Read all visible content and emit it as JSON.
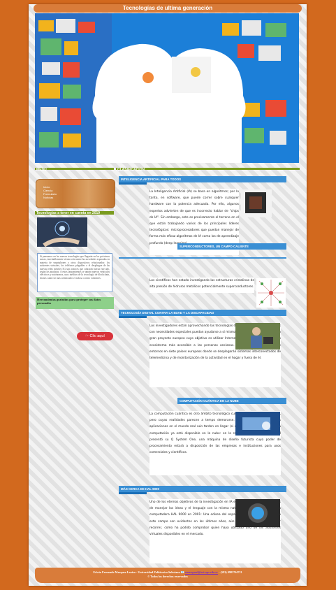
{
  "header": {
    "title": "Tecnologías de ultima generación"
  },
  "sidebar": {
    "menu_label": "MENÚ",
    "items": [
      {
        "label": "Inicio"
      },
      {
        "label": "Ciencia"
      },
      {
        "label": "Formulario"
      },
      {
        "label": "Noticias"
      }
    ],
    "tech_title": "Tecnologías a tener en cuenta en 2019",
    "tech_text": "Si pensamos en las nuevas tecnologías que llegarán en los próximos meses, inevitablemente vienen a la mente las novedades esperadas en materia de smartphones y otros dispositivos relacionados: los asistentes virtuales, los teléfonos plegables o el despliegue de las nuevas redes móviles 5G son avances que cobrarán fuerza este año, según los analistas. A estos lanzamientos se unirán nuevos vehículos eléctricos y autónomos, usos inéditos de la tecnología de blockchain, drones cada vez más sofisticados e incluso coches voladores.",
    "tools_title": "Herramientas gratuitas para proteger sus datos personales",
    "clic_label": "Clic aquí"
  },
  "main": {
    "section_label": "CLASIFICACIÓN",
    "articles": [
      {
        "title": "INTELIGENCIA ARTIFICIAL PARA TODOS",
        "text": "La Inteligencia Artificial (IA) se basa en algoritmos; por lo tanto, en software, que puede correr sobre cualquier hardware con la potencia adecuada. Por ello, algunos expertos advierten de que es incorrecto hablar de \"chips de IA\". Sin embargo, este es precisamente el terreno en el que están trabajando varios de los principales líderes tecnológicos: microprocesadores que puedan manejar de forma más eficaz algoritmos de IA como los de aprendizaje profundo (deep learning)."
      },
      {
        "title": "SUPERCONDUCTORES, UN CAMPO CALIENTE",
        "text": "Los científicos han estado investigando las estructuras cristalinas de alta presión de hidruros metálicos potencialmente superconductores."
      },
      {
        "title": "TECNOLOGÍA DIGITAL CONTRA LA EDAD Y LA DISCAPACIDAD",
        "text": "Los investigadores están aprovechando las tecnologías digitales para que las personas con necesidades especiales puedan ayudarse a sí mismas. Es el caso de ACTIVAGE, un gran proyecto europeo cuyo objetivo es utilizar Internet de las Cosas para crear un ecosistema más accesible a las personas ancianas. El objetivo es crear nueve entornos en siete países europeos donde se desplegarán sistemas interconectados de telemedicina y de monitorización de la actividad en el hogar y fuera de él."
      },
      {
        "title": "COMPUTACIÓN CUÁNTICA EN LA NUBE",
        "text": "La computación cuántica es otro ámbito tecnológico cuyas promesas son tentadoras, pero cuyas realidades parecen a tempo demorarse. No obstante y aunque sus aplicaciones en el mundo real aún tarden en llegar (si es que llegan), el futuro de la computación ya está disponible en la nube: en la reciente edición del CES, IBM presentó su Q System One, una máquina de diseño futurista cuyo poder de procesamiento estará a disposición de las empresas e instituciones para usos comerciales y científicos."
      },
      {
        "title": "MÁS CERCA DE HAL 9000",
        "text": "Uno de los eternos objetivos de la investigación en IA es conseguir sistemas capaces de manejar las ideas y el lenguaje con la misma naturalidad con que lo hacía la computadora HAL 9000 en 2001: Una odisea del espacio. Aunque los progresos en este campo son evidentes en los últimos años, aún queda un largo camino por recorrer, como ha podido comprobar quien haya utilizado uno de los asistentes virtuales disponibles en el mercado."
      }
    ]
  },
  "footer": {
    "author": "Edwin Fernando Marquez Loaiza - Universidad Politécnica Salesiana 📧",
    "email": "emarquezl@est.ups.edu.ec",
    "phone": "- (593) 0983764721",
    "rights": "© Todos los derechos reservados"
  },
  "colors": {
    "background": "#d2691e",
    "accent_orange": "#d97c3a",
    "section_blue": "#3a8fd4",
    "menu_green": "#7a9b1e",
    "button_red": "#d8323a"
  }
}
